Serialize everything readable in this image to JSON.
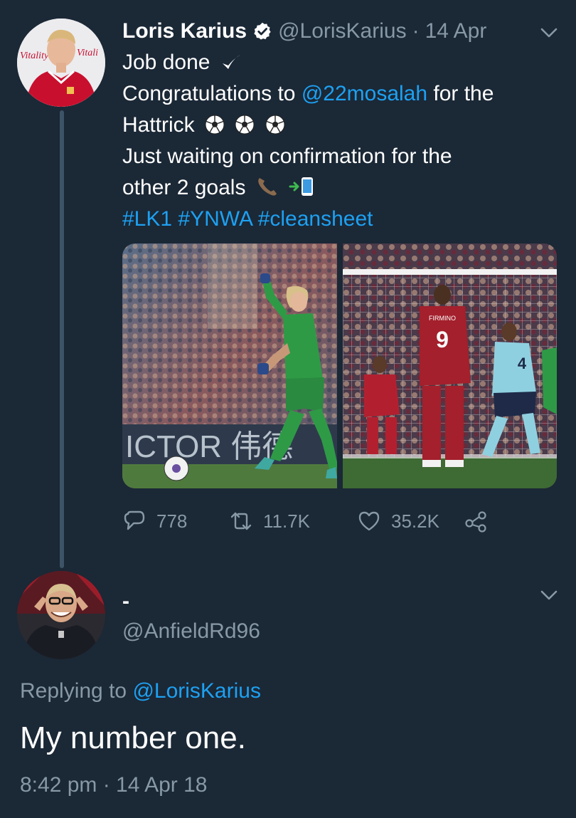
{
  "tweet": {
    "display_name": "Loris Karius",
    "handle": "@LorisKarius",
    "separator": "·",
    "date": "14 Apr",
    "text_line1": "Job done",
    "text_line2_prefix": "Congratulations to ",
    "text_line2_mention": "@22mosalah",
    "text_line2_suffix": " for the",
    "text_line3": "Hattrick",
    "text_line4": "Just waiting on confirmation for the",
    "text_line5": "other 2 goals",
    "hashtag1": "#LK1",
    "hashtag2": "#YNWA",
    "hashtag3": "#cleansheet",
    "photo1_banner": "ICTOR 伟德",
    "photo2_shirt_number": "9",
    "photo2_shirt_name": "FIRMINO",
    "photo2_defender_number": "4",
    "avatar_sponsor_left": "Vitality",
    "avatar_sponsor_right": "Vitali",
    "stats": {
      "replies": "778",
      "retweets": "11.7K",
      "likes": "35.2K"
    }
  },
  "reply": {
    "display_name": "-",
    "handle": "@AnfieldRd96",
    "replying_label": "Replying to ",
    "replying_handle": "@LorisKarius",
    "text": "My number one.",
    "timestamp": "8:42 pm · 14 Apr 18"
  },
  "colors": {
    "background": "#1b2836",
    "link": "#1da1f2",
    "secondary_text": "#8899a6",
    "verified_badge": "#ffffff"
  },
  "icons": {
    "verified": "verified-badge-icon",
    "chevron": "chevron-down-icon",
    "reply": "reply-bubble-icon",
    "retweet": "retweet-icon",
    "like": "heart-icon",
    "share": "share-icon",
    "soccer_ball": "soccer-ball-icon",
    "phone": "telephone-receiver-icon",
    "mobile": "mobile-phone-with-arrow-icon",
    "check": "check-mark-icon"
  }
}
